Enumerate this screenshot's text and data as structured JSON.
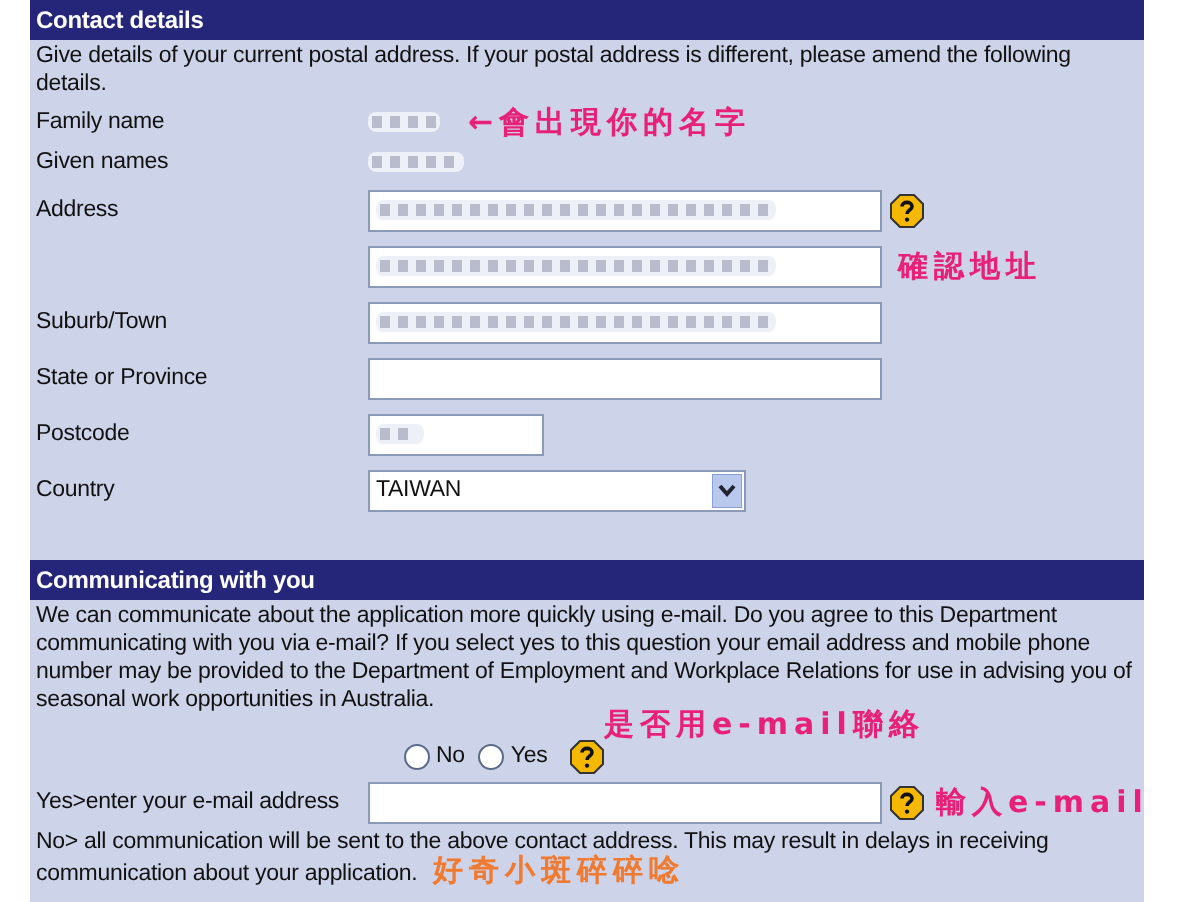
{
  "sections": [
    {
      "title": "Contact details",
      "intro": "Give details of your current postal address. If your postal address is different, please amend the following details.",
      "rows": [
        {
          "kind": "static",
          "label": "Family name",
          "redacted": true,
          "note": {
            "text": "←會出現你的名字",
            "color": "#e8207a"
          }
        },
        {
          "kind": "static",
          "label": "Given names",
          "redacted": true
        },
        {
          "kind": "input",
          "label": "Address",
          "redacted": true,
          "help": true
        },
        {
          "kind": "input",
          "redacted": true,
          "note": {
            "text": "確認地址",
            "color": "#e8207a"
          }
        },
        {
          "kind": "input",
          "label": "Suburb/Town",
          "redacted": true
        },
        {
          "kind": "input",
          "label": "State or Province",
          "redacted": false
        },
        {
          "kind": "short",
          "label": "Postcode",
          "redacted": true
        },
        {
          "kind": "select",
          "label": "Country",
          "value": "TAIWAN"
        }
      ]
    },
    {
      "title": "Communicating with you",
      "intro": "We can communicate about the application more quickly using e-mail. Do you agree to this Department communicating with you via e-mail? If you select yes to this question your email address and mobile phone number may be provided to the Department of Employment and Workplace Relations for use in advising you of seasonal work opportunities in Australia.",
      "note": {
        "text": "是否用e-mail聯絡",
        "color": "#e8207a"
      },
      "radios": [
        {
          "label": "No",
          "selected": false
        },
        {
          "label": "Yes",
          "selected": false
        }
      ],
      "rows": [
        {
          "kind": "input",
          "label": "Yes>enter your e-mail address",
          "redacted": false,
          "help": true,
          "note": {
            "text": "輸入e-mail",
            "color": "#e8207a"
          }
        }
      ],
      "outro": "No> all communication will be sent to the above contact address. This may result in delays in receiving communication about your application.",
      "outro_note": {
        "text": "好奇小斑碎碎唸",
        "color": "#f07a30"
      }
    }
  ]
}
